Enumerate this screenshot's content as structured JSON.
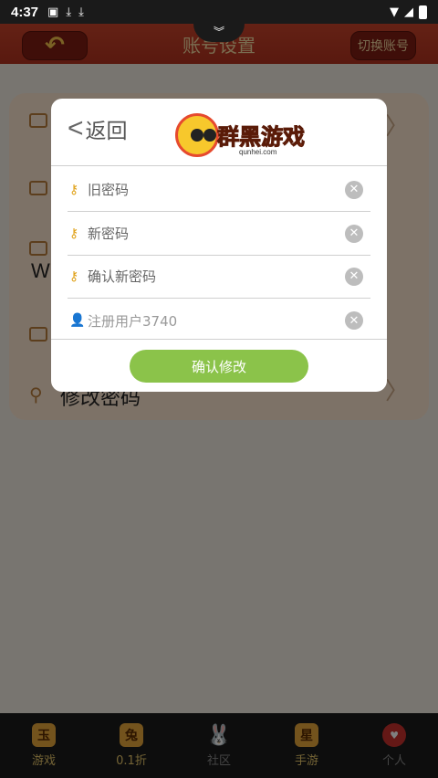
{
  "status_bar": {
    "time": "4:37",
    "icons": [
      "photo-icon",
      "download-icon",
      "download-icon",
      "wifi-icon",
      "signal-icon",
      "battery-icon"
    ]
  },
  "header": {
    "title": "账号设置",
    "switch_account_label": "切换账号",
    "accent_color": "#c0392b"
  },
  "background_card": {
    "partial_text": "W",
    "change_password_label": "修改密码"
  },
  "modal": {
    "back_label": "返回",
    "logo_title": "群黑游戏",
    "logo_subtitle": "qunhei.com",
    "fields": [
      {
        "placeholder": "旧密码",
        "icon": "key-icon"
      },
      {
        "placeholder": "新密码",
        "icon": "key-icon"
      },
      {
        "placeholder": "确认新密码",
        "icon": "key-icon"
      },
      {
        "placeholder": "注册用户3740",
        "icon": "user-icon"
      }
    ],
    "confirm_label": "确认修改",
    "confirm_color": "#8bc34a"
  },
  "bottom_nav": {
    "items": [
      {
        "label": "游戏",
        "icon_text": "玉"
      },
      {
        "label": "0.1折",
        "icon_text": "兔"
      },
      {
        "label": "社区",
        "icon_text": "🐰"
      },
      {
        "label": "手游",
        "icon_text": "星"
      },
      {
        "label": "个人",
        "icon_text": "♥"
      }
    ]
  }
}
